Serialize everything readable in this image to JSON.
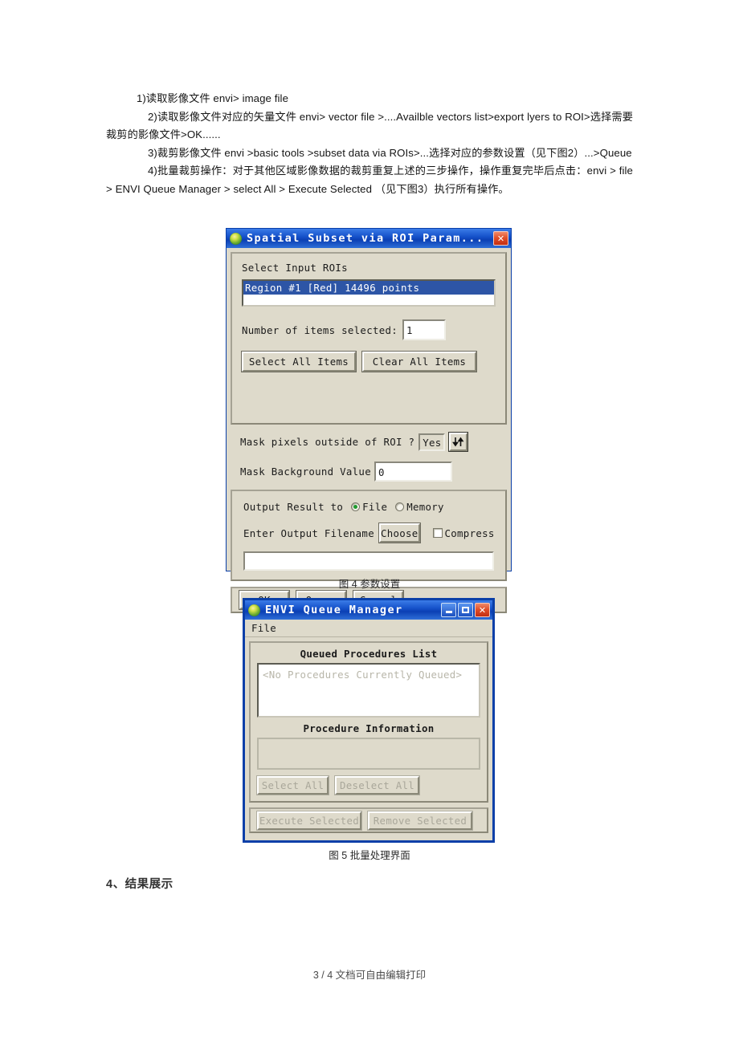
{
  "document": {
    "paragraphs": [
      "1)读取影像文件  envi> image file",
      "2)读取影像文件对应的矢量文件  envi> vector file >....Availble vectors list>export lyers to ROI>选择需要裁剪的影像文件>OK......",
      "3)裁剪影像文件    envi  >basic  tools  >subset  data  via  ROIs>...选择对应的参数设置（见下图2）...>Queue",
      "4)批量裁剪操作：对于其他区域影像数据的裁剪重复上述的三步操作，操作重复完毕后点击：envi > file > ENVI Queue Manager > select All > Execute Selected  （见下图3）执行所有操作。"
    ],
    "section_heading": "4、结果展示",
    "footer": "3 / 4 文档可自由编辑打印",
    "caption_fig4": "图 4  参数设置",
    "caption_fig5": "图  5 批量处理界面"
  },
  "colors": {
    "titlebar_blue": "#1551c9",
    "dialog_tan": "#dedacb",
    "selection_blue": "#2d55a6",
    "close_red": "#e2502a",
    "disabled_gray": "#a9a79a"
  },
  "subset_dialog": {
    "title": "Spatial Subset via ROI Param...",
    "icon": "envi-globe-icon",
    "close_label": "✕",
    "roi_group": {
      "label": "Select Input ROIs",
      "items": [
        "Region #1 [Red] 14496 points"
      ],
      "count_label": "Number of items selected:",
      "count_value": "1",
      "select_all_label": "Select All Items",
      "clear_all_label": "Clear All Items"
    },
    "mask_label": "Mask pixels outside of ROI ?",
    "mask_value": "Yes",
    "mask_toggle_icon": "up-down-arrows-icon",
    "mask_bg_label": "Mask Background Value",
    "mask_bg_value": "0",
    "output": {
      "label": "Output Result to",
      "options": [
        "File",
        "Memory"
      ],
      "selected": "File",
      "filename_label": "Enter Output Filename",
      "choose_label": "Choose",
      "compress_label": "Compress",
      "compress_checked": false,
      "filename_value": ""
    },
    "buttons": [
      "OK",
      "Queue",
      "Cancel"
    ]
  },
  "queue_dialog": {
    "title": "ENVI Queue Manager",
    "icon": "envi-globe-icon",
    "minimize_label": "_",
    "maximize_label": "□",
    "close_label": "✕",
    "menu": [
      "File"
    ],
    "queued_list_title": "Queued Procedures List",
    "queued_list_empty": "<No Procedures Currently Queued>",
    "procedure_info_title": "Procedure Information",
    "procedure_info_value": "",
    "select_all_label": "Select All",
    "deselect_all_label": "Deselect All",
    "execute_label": "Execute Selected",
    "remove_label": "Remove Selected"
  }
}
